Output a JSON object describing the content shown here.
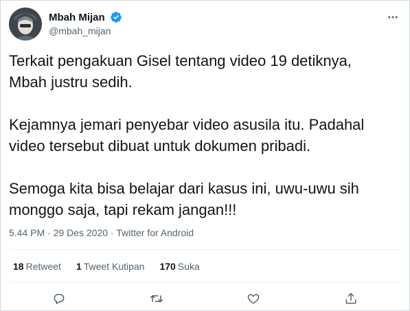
{
  "author": {
    "display_name": "Mbah Mijan",
    "handle": "@mbah_mijan",
    "verified": true
  },
  "tweet": {
    "text": "Terkait pengakuan Gisel tentang video 19 detiknya,\nMbah justru sedih.\n\nKejamnya jemari penyebar video asusila itu. Padahal\nvideo tersebut dibuat untuk dokumen pribadi.\n\nSemoga kita bisa belajar dari kasus ini, uwu-uwu sih\nmonggo saja, tapi rekam jangan!!!"
  },
  "meta": {
    "time": "5.44 PM",
    "separator": "·",
    "date": "29 Des 2020",
    "source": "Twitter for Android"
  },
  "stats": {
    "retweets": {
      "count": "18",
      "label": "Retweet"
    },
    "quotes": {
      "count": "1",
      "label": "Tweet Kutipan"
    },
    "likes": {
      "count": "170",
      "label": "Suka"
    }
  },
  "icons": {
    "verified": "verified-badge-icon",
    "more": "more-options-icon",
    "reply": "reply-icon",
    "retweet": "retweet-icon",
    "like": "like-icon",
    "share": "share-icon"
  },
  "colors": {
    "text": "#0f1419",
    "secondary": "#536471",
    "verified": "#1d9bf0",
    "border": "#cfd9de"
  }
}
